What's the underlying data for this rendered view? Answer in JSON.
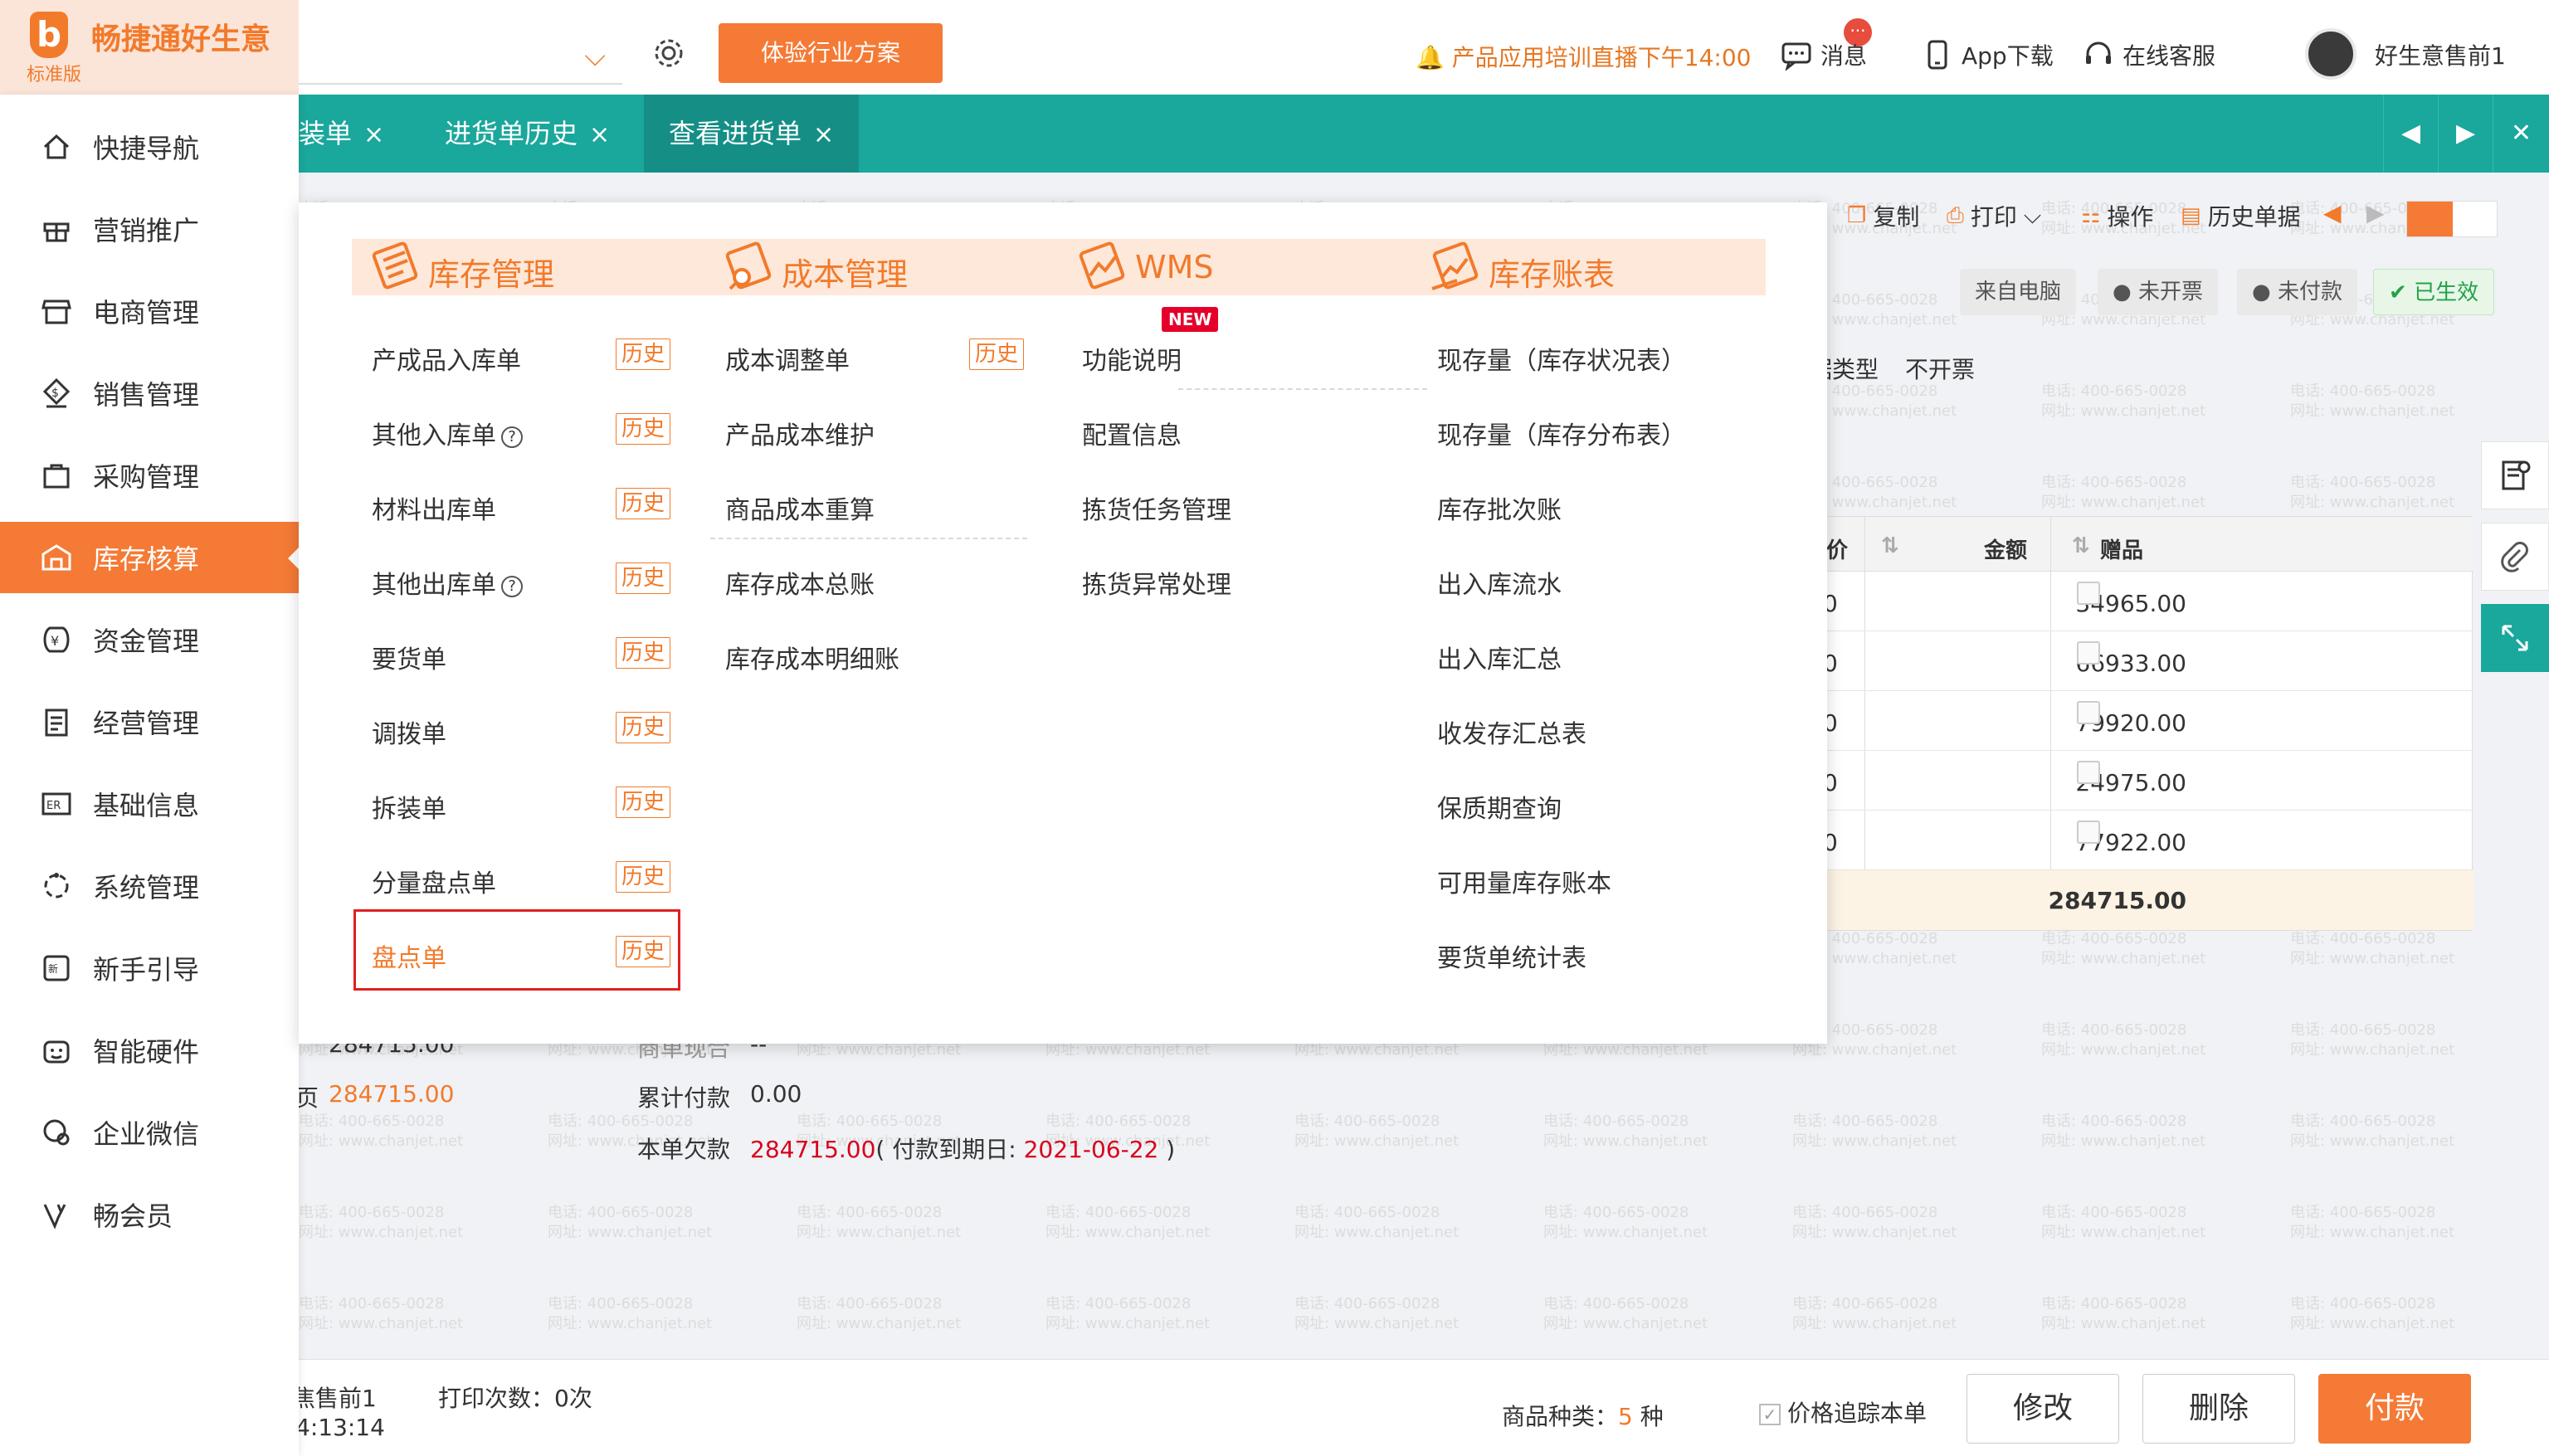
{
  "brand": {
    "name": "畅捷通好生意",
    "edition": "标准版"
  },
  "header": {
    "trial_button": "体验行业方案",
    "live_notice": "产品应用培训直播下午14:00",
    "messages": "消息",
    "message_badge": "···",
    "app_download": "App下载",
    "online_service": "在线客服",
    "user": "好生意售前1"
  },
  "tabs": [
    {
      "label": "装单"
    },
    {
      "label": "进货单历史"
    },
    {
      "label": "查看进货单"
    }
  ],
  "tab_close": "×",
  "tab_nav": {
    "prev": "◀",
    "next": "▶",
    "close": "✕"
  },
  "sidebar": {
    "items": [
      {
        "label": "快捷导航",
        "icon": "home-icon"
      },
      {
        "label": "营销推广",
        "icon": "gift-icon"
      },
      {
        "label": "电商管理",
        "icon": "store-icon"
      },
      {
        "label": "销售管理",
        "icon": "sales-icon"
      },
      {
        "label": "采购管理",
        "icon": "bag-icon"
      },
      {
        "label": "库存核算",
        "icon": "warehouse-icon"
      },
      {
        "label": "资金管理",
        "icon": "yen-icon"
      },
      {
        "label": "经营管理",
        "icon": "clipboard-icon"
      },
      {
        "label": "基础信息",
        "icon": "id-card-icon"
      },
      {
        "label": "系统管理",
        "icon": "system-icon"
      },
      {
        "label": "新手引导",
        "icon": "new-icon"
      },
      {
        "label": "智能硬件",
        "icon": "device-icon"
      },
      {
        "label": "企业微信",
        "icon": "wechat-icon"
      },
      {
        "label": "畅会员",
        "icon": "vip-icon"
      }
    ],
    "active_index": 5
  },
  "toolbar": {
    "copy": "复制",
    "print": "打印",
    "operate": "操作",
    "history": "历史单据"
  },
  "statuses": {
    "source": "来自电脑",
    "invoice": "未开票",
    "payment": "未付款",
    "effective": "已生效"
  },
  "doc": {
    "type_label": "据类型",
    "type_value": "不开票"
  },
  "grid": {
    "partial_header": "价",
    "amount_header": "金额",
    "gift_header": "赠品",
    "partial_col": [
      "0",
      "0",
      "0",
      "0",
      "0"
    ],
    "amounts": [
      "34965.00",
      "66933.00",
      "79920.00",
      "24975.00",
      "77922.00"
    ],
    "total": "284715.00"
  },
  "summary": {
    "partial_top_value": "284715.00",
    "partial_top_label": "商单现合",
    "partial_top_value2": "--",
    "total_label_fragment": "页",
    "total_value": "284715.00",
    "paid_label": "累计付款",
    "paid_value": "0.00",
    "due_label": "本单欠款",
    "due_value": "284715.00",
    "due_date_prefix": "( 付款到期日: ",
    "due_date": "2021-06-22",
    "due_date_suffix": " )"
  },
  "bottom": {
    "maker": "焦售前1",
    "print_count": "打印次数：0次",
    "time": "4:13:14",
    "kinds_label": "商品种类：",
    "kinds_value": "5",
    "kinds_unit": "种",
    "price_trace": "价格追踪本单",
    "modify": "修改",
    "delete": "删除",
    "pay": "付款"
  },
  "menu": {
    "columns": [
      {
        "title": "库存管理",
        "items": [
          {
            "label": "产成品入库单",
            "history": "历史"
          },
          {
            "label": "其他入库单",
            "help": "?",
            "history": "历史"
          },
          {
            "label": "材料出库单",
            "history": "历史"
          },
          {
            "label": "其他出库单",
            "help": "?",
            "history": "历史"
          },
          {
            "label": "要货单",
            "history": "历史"
          },
          {
            "label": "调拨单",
            "history": "历史"
          },
          {
            "label": "拆装单",
            "history": "历史"
          },
          {
            "label": "分量盘点单",
            "history": "历史"
          },
          {
            "label": "盘点单",
            "history": "历史"
          }
        ]
      },
      {
        "title": "成本管理",
        "items": [
          {
            "label": "成本调整单",
            "history": "历史"
          },
          {
            "label": "产品成本维护"
          },
          {
            "label": "商品成本重算"
          },
          {
            "label": "库存成本总账"
          },
          {
            "label": "库存成本明细账"
          }
        ]
      },
      {
        "title": "WMS",
        "items": [
          {
            "label": "功能说明",
            "badge": "NEW"
          },
          {
            "label": "配置信息"
          },
          {
            "label": "拣货任务管理"
          },
          {
            "label": "拣货异常处理"
          }
        ]
      },
      {
        "title": "库存账表",
        "items": [
          {
            "label": "现存量（库存状况表）"
          },
          {
            "label": "现存量（库存分布表）"
          },
          {
            "label": "库存批次账"
          },
          {
            "label": "出入库流水"
          },
          {
            "label": "出入库汇总"
          },
          {
            "label": "收发存汇总表"
          },
          {
            "label": "保质期查询"
          },
          {
            "label": "可用量库存账本"
          },
          {
            "label": "要货单统计表"
          }
        ]
      }
    ]
  },
  "watermark": {
    "line1": "电话: 400-665-0028",
    "line2": "网址: www.chanjet.net"
  },
  "colors": {
    "accent": "#f47a35",
    "teal": "#1aa79c",
    "highlight_box": "#e02020"
  }
}
